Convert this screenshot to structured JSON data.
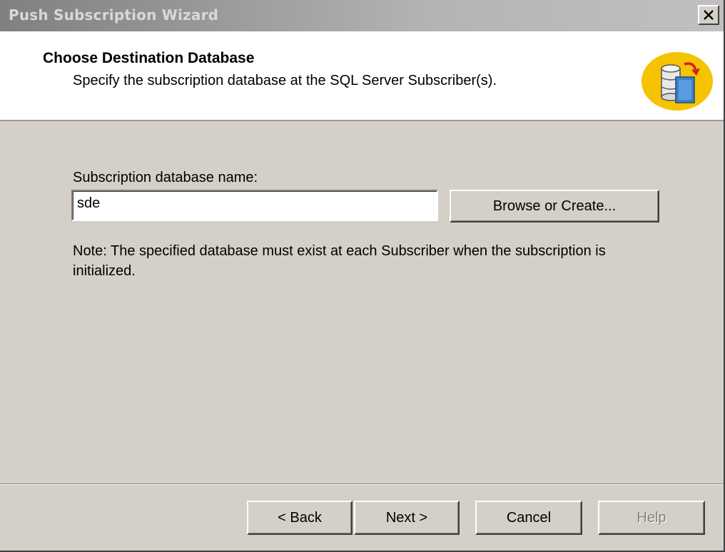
{
  "window": {
    "title": "Push Subscription Wizard",
    "close_symbol": "✕"
  },
  "header": {
    "title": "Choose Destination Database",
    "subtitle": "Specify the subscription database at the SQL Server Subscriber(s).",
    "icon": "database-replication-icon"
  },
  "form": {
    "label": "Subscription database name:",
    "value": "sde",
    "browse_label": "Browse or Create...",
    "note": "Note: The specified database must exist at each Subscriber when the subscription is initialized."
  },
  "footer": {
    "back_label": "< Back",
    "next_label": "Next >",
    "cancel_label": "Cancel",
    "help_label": "Help"
  },
  "colors": {
    "dialog_bg": "#d4d0c8",
    "icon_yellow": "#f5c300"
  }
}
